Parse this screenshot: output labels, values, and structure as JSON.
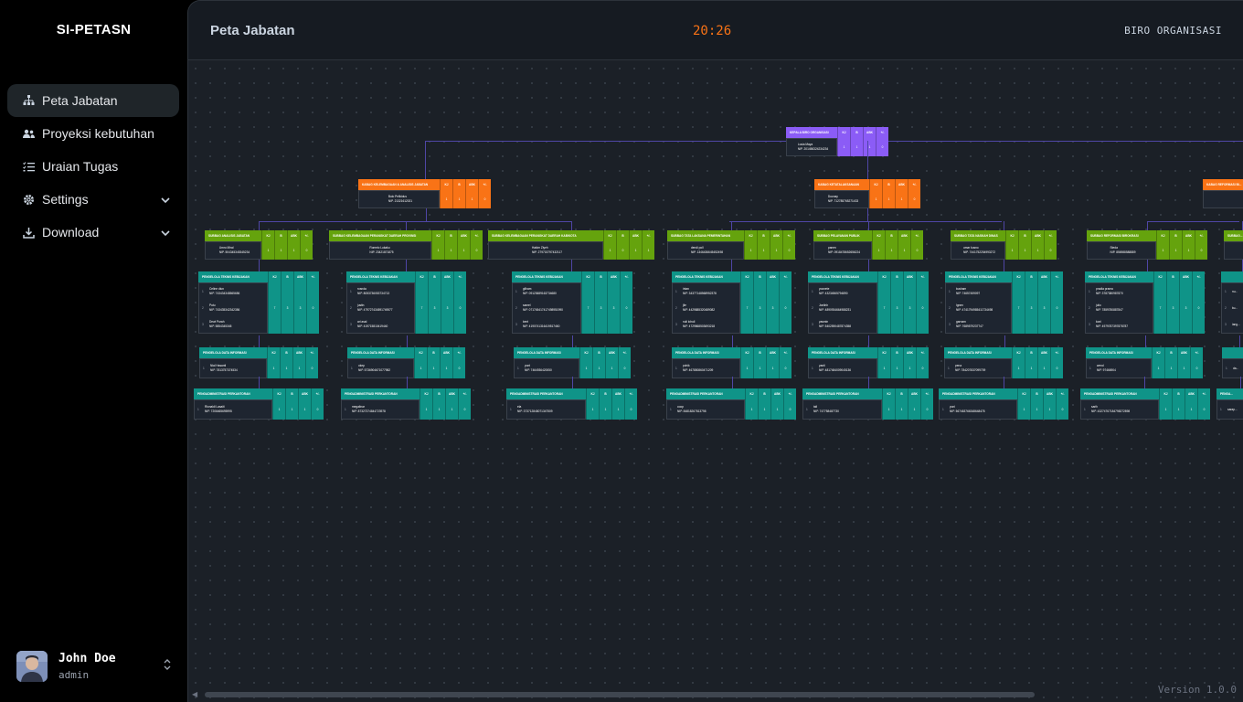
{
  "app": {
    "brand": "SI-PETASN"
  },
  "sidebar": {
    "items": [
      {
        "label": "Peta Jabatan",
        "icon": "sitemap-icon",
        "active": true
      },
      {
        "label": "Proyeksi kebutuhan",
        "icon": "users-icon"
      },
      {
        "label": "Uraian Tugas",
        "icon": "list-icon"
      },
      {
        "label": "Settings",
        "icon": "gear-icon",
        "expandable": true
      },
      {
        "label": "Download",
        "icon": "download-icon",
        "expandable": true
      }
    ]
  },
  "user": {
    "name": "John Doe",
    "role": "admin"
  },
  "header": {
    "title": "Peta Jabatan",
    "clock": "20:26",
    "org": "BIRO ORGANISASI"
  },
  "footer": {
    "version": "Version 1.0.0"
  },
  "colors": {
    "purple": "#8b5cf6",
    "orange": "#f97316",
    "green": "#65a30d",
    "teal": "#0f9488",
    "clock": "#f97316"
  },
  "chart": {
    "cols": [
      "KJ",
      "B",
      "ABK",
      "+/-"
    ],
    "root": {
      "title": "KEPALA BIRO ORGANISASI",
      "name": "Lusia Maya",
      "nip": "NIP. 201456324234234",
      "vals": [
        "1",
        "1",
        "1",
        "0"
      ]
    },
    "level2": [
      {
        "title": "KABAG KELEMBAGAAN & ANALISIS JABATAN",
        "name": "Bulo Pelikidus",
        "nip": "NIP. 21321612021",
        "vals": [
          "1",
          "1",
          "1",
          "0"
        ]
      },
      {
        "title": "KABAG KETATALAKSANAAN",
        "name": "Duonay",
        "nip": "NIP. 712785765271433",
        "vals": [
          "1",
          "1",
          "1",
          "0"
        ]
      },
      {
        "title": "KABAG REFORMASI BI...",
        "name": "",
        "nip": "NIP.",
        "vals": []
      }
    ],
    "level3": [
      {
        "title": "SUBBAG ANALISIS JABATAN",
        "name": "Umro Miral",
        "nip": "NIP. 504345345345234",
        "vals": [
          "1",
          "1",
          "1",
          "0"
        ]
      },
      {
        "title": "SUBBAG KELEMBAGAAN PERANGKAT DAERAH PROVINSI",
        "name": "Romelo Lukaku",
        "nip": "NIP. 23421871875",
        "vals": [
          "1",
          "1",
          "1",
          "0"
        ]
      },
      {
        "title": "SUBBAG KELEMBAGAAN PERANGKAT DAERAH KAB/KOTA",
        "name": "Hakim Ziyeh",
        "nip": "NIP. 279715797432117",
        "vals": [
          "1",
          "0",
          "1",
          "1"
        ]
      },
      {
        "title": "SUBBAG TATA LAKSANA PEMERINTAHAN",
        "name": "dendi poll",
        "nip": "NIP. 1346436645452498",
        "vals": [
          "1",
          "1",
          "1",
          "0"
        ]
      },
      {
        "title": "SUBBAG PELAYANAN PUBLIK",
        "name": "panen",
        "nip": "NIP. 0918478652656224",
        "vals": [
          "1",
          "1",
          "1",
          "0"
        ]
      },
      {
        "title": "SUBBAG TATA NASKAH DINAS",
        "name": "umar kusno",
        "nip": "NIP. 7441752254993272",
        "vals": [
          "1",
          "1",
          "1",
          "0"
        ]
      },
      {
        "title": "SUBBAG REFORMASI BIROKRASI",
        "name": "Steda",
        "nip": "NIP. 856988588889",
        "vals": [
          "1",
          "1",
          "1",
          "0"
        ]
      },
      {
        "title": "SUBBAG...",
        "name": "",
        "nip": "",
        "vals": []
      }
    ],
    "analis": [
      {
        "title": "PENGELOLA TEKNIS KEBIJAKAN",
        "people": [
          [
            "Celine diun",
            "NIP. 743434348565656"
          ],
          [
            "Putu",
            "NIP. 743435342342356"
          ],
          [
            "Dewi Purah",
            "NIP. 5854345345"
          ]
        ],
        "vals": [
          "7",
          "3",
          "3",
          "0"
        ]
      },
      {
        "title": "PENGELOLA TEKNIS KEBIJAKAN",
        "people": [
          [
            "rosnda",
            "NIP. 8053736053734713"
          ],
          [
            "justin",
            "NIP. 479727434591749577"
          ],
          [
            "ari asal",
            "NIP. 419715810419440"
          ]
        ],
        "vals": [
          "7",
          "3",
          "3",
          "0"
        ]
      },
      {
        "title": "PENGELOLA TEKNIS KEBIJAKAN",
        "people": [
          [
            "gilham",
            "NIP. 09123689163734680"
          ],
          [
            "samel",
            "NIP. 071745417417498951990"
          ],
          [
            "kent",
            "NIP. 4190741316419517460"
          ]
        ],
        "vals": [
          "7",
          "3",
          "3",
          "0"
        ]
      },
      {
        "title": "PENGELOLA TEKNIS KEBIJAKAN",
        "people": [
          [
            "intan",
            "NIP. 34377148568952378"
          ],
          [
            "jile",
            "NIP. 4429885320489082"
          ],
          [
            "nuli lohuli",
            "NIP. 4729868503693218"
          ]
        ],
        "vals": [
          "7",
          "3",
          "3",
          "0"
        ]
      },
      {
        "title": "PENGELOLA TEKNIS KEBIJAKAN",
        "people": [
          [
            "yoonete",
            "NIP. 43234565794890"
          ],
          [
            "Jonlinh",
            "NIP. 4890934664988231"
          ],
          [
            "yasmin",
            "NIP. 5402590487874358"
          ]
        ],
        "vals": [
          "7",
          "3",
          "3",
          "0"
        ]
      },
      {
        "title": "PENGELOLA TEKNIS KEBIJAKAN",
        "people": [
          [
            "kusham",
            "NIP. 74657459097"
          ],
          [
            "Ignen",
            "NIP. 4741794985411734498"
          ],
          [
            "garnam",
            "NIP. 7689579237747"
          ]
        ],
        "vals": [
          "7",
          "3",
          "3",
          "0"
        ]
      },
      {
        "title": "PENGELOLA TEKNIS KEBIJAKAN",
        "people": [
          [
            "pradia prama",
            "NIP. 3787380987870"
          ],
          [
            "julio",
            "NIP. 7859780887847"
          ],
          [
            "koni",
            "NIP. 4979787397878787"
          ]
        ],
        "vals": [
          "7",
          "3",
          "3",
          "0"
        ]
      },
      {
        "title": "",
        "people": [
          [
            "nu...",
            ""
          ],
          [
            "ku...",
            ""
          ],
          [
            "lang...",
            ""
          ]
        ],
        "vals": []
      }
    ],
    "pengelola": [
      {
        "title": "PENGELOLA DATA INFORMASI",
        "people": [
          [
            "Nial Hasanti",
            "NIP. 7813757374534"
          ]
        ],
        "vals": [
          "1",
          "1",
          "1",
          "0"
        ]
      },
      {
        "title": "PENGELOLA DATA INFORMASI",
        "people": [
          [
            "okep",
            "NIP. 5736904671077982"
          ]
        ],
        "vals": [
          "1",
          "1",
          "1",
          "0"
        ]
      },
      {
        "title": "PENGELOLA DATA INFORMASI",
        "people": [
          [
            "yunt",
            "NIP. 7464936420050"
          ]
        ],
        "vals": [
          "1",
          "1",
          "1",
          "0"
        ]
      },
      {
        "title": "PENGELOLA DATA INFORMASI",
        "people": [
          [
            "pohik",
            "NIP. 467850860471209"
          ]
        ],
        "vals": [
          "1",
          "1",
          "1",
          "0"
        ]
      },
      {
        "title": "PENGELOLA DATA INFORMASI",
        "people": [
          [
            "yanti",
            "NIP. 4817484009045136"
          ]
        ],
        "vals": [
          "1",
          "1",
          "1",
          "0"
        ]
      },
      {
        "title": "PENGELOLA DATA INFORMASI",
        "people": [
          [
            "pena",
            "NIP. 784207837099709"
          ]
        ],
        "vals": [
          "1",
          "1",
          "1",
          "0"
        ]
      },
      {
        "title": "PENGELOLA DATA INFORMASI",
        "people": [
          [
            "wend",
            "NIP. 97466904"
          ]
        ],
        "vals": [
          "1",
          "1",
          "1",
          "0"
        ]
      },
      {
        "title": "",
        "people": [
          [
            "da...",
            ""
          ]
        ],
        "vals": []
      }
    ],
    "pengadministrasi": [
      {
        "title": "PENGADMINISTRASI PERKANTORAN",
        "people": [
          [
            "Rionaldi Lasaiti",
            "NIP. 7206465695995"
          ]
        ],
        "vals": [
          "1",
          "1",
          "1",
          "0"
        ]
      },
      {
        "title": "PENGADMINISTRASI PERKANTORAN",
        "people": [
          [
            "megalinar",
            "NIP. 87327374844723978"
          ]
        ],
        "vals": [
          "1",
          "1",
          "1",
          "0"
        ]
      },
      {
        "title": "PENGADMINISTRASI PERKANTORAN",
        "people": [
          [
            "ela",
            "NIP. 373712848071347509"
          ]
        ],
        "vals": [
          "1",
          "1",
          "1",
          "0"
        ]
      },
      {
        "title": "PENGADMINISTRASI PERKANTORAN",
        "people": [
          [
            "coop",
            "NIP. 84818267813798"
          ]
        ],
        "vals": [
          "1",
          "1",
          "1",
          "0"
        ]
      },
      {
        "title": "PENGADMINISTRASI PERKANTORAN",
        "people": [
          [
            "tali",
            "NIP. 747758487730"
          ]
        ],
        "vals": [
          "1",
          "1",
          "1",
          "0"
        ]
      },
      {
        "title": "PENGADMINISTRASI PERKANTORAN",
        "people": [
          [
            "yuni",
            "NIP. 567463766348648478"
          ]
        ],
        "vals": [
          "1",
          "1",
          "1",
          "0"
        ]
      },
      {
        "title": "PENGADMINISTRASI PERKANTORAN",
        "people": [
          [
            "sarih",
            "NIP. 43274767184798272898"
          ]
        ],
        "vals": [
          "1",
          "1",
          "1",
          "0"
        ]
      },
      {
        "title": "PENGA...",
        "people": [
          [
            "sarap...",
            ""
          ]
        ],
        "vals": []
      }
    ]
  }
}
